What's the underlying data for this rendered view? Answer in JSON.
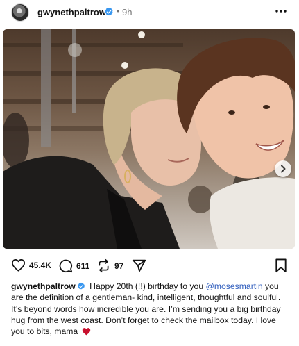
{
  "post": {
    "username": "gwynethpaltrow",
    "separator": "•",
    "time": "9h"
  },
  "media": {
    "carousel_count": 4,
    "active_index": 0
  },
  "actions": {
    "likes": "45.4K",
    "comments": "611",
    "reposts": "97"
  },
  "caption": {
    "username": "gwynethpaltrow",
    "text_before_mention": "Happy 20th (!!) birthday to you ",
    "mention": "@mosesmartin",
    "text_after_mention": " you are the definition of a gentleman- kind, intelligent, thoughtful and soulful. It’s beyond words how incredible you are. I’m sending you a big birthday hug from the west coast. Don’t forget to check the mailbox today. I love you to bits, mama "
  },
  "colors": {
    "verified": "#3897f0",
    "heart": "#c8102e",
    "mention": "#2f5dbd"
  },
  "icons": [
    "more-icon",
    "verified-icon",
    "chevron-right-icon",
    "heart-icon",
    "comment-icon",
    "repost-icon",
    "share-icon",
    "bookmark-icon",
    "red-heart-emoji-icon"
  ]
}
